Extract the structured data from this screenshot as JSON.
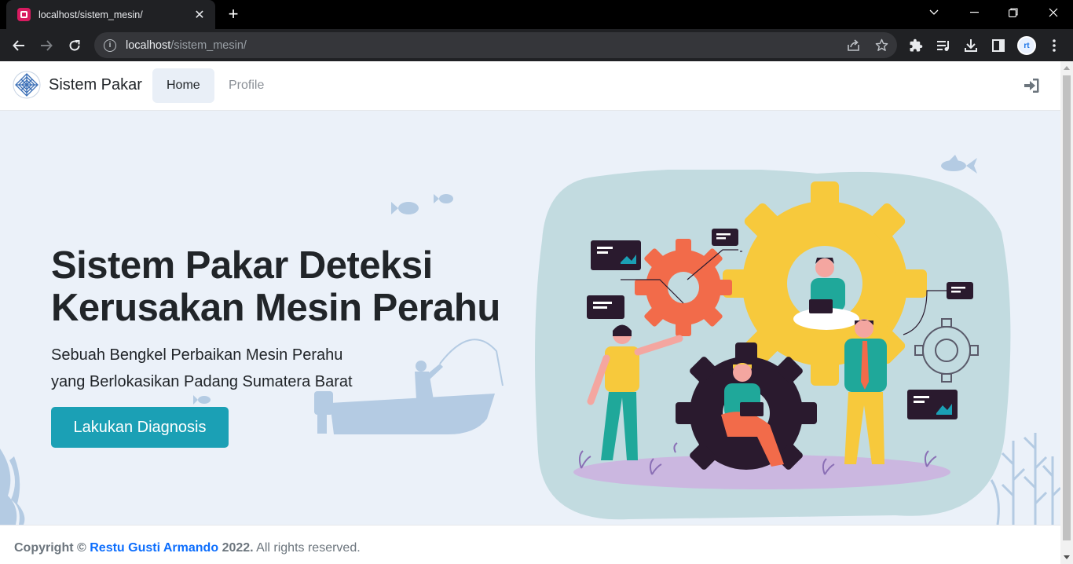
{
  "browser": {
    "tab_title": "localhost/sistem_mesin/",
    "url_host": "localhost",
    "url_path": "/sistem_mesin/",
    "avatar_initials": "rt"
  },
  "navbar": {
    "brand": "Sistem Pakar",
    "links": [
      {
        "label": "Home",
        "active": true
      },
      {
        "label": "Profile",
        "active": false
      }
    ],
    "login_icon": "sign-in-icon"
  },
  "hero": {
    "title": "Sistem Pakar Deteksi Kerusakan Mesin Perahu",
    "subtitle_line1": "Sebuah Bengkel Perbaikan Mesin Perahu",
    "subtitle_line2": "yang Berlokasikan Padang Sumatera Barat",
    "cta": "Lakukan Diagnosis"
  },
  "footer": {
    "prefix": "Copyright ©",
    "author": "Restu Gusti Armando",
    "year": "2022.",
    "suffix": "All rights reserved."
  },
  "colors": {
    "accent": "#1ba0b5",
    "hero_bg": "#ebf1f9",
    "link": "#0d6efd",
    "gear_yellow": "#f7c93c",
    "gear_orange": "#f26b4a",
    "gear_dark": "#2a1a2e"
  }
}
